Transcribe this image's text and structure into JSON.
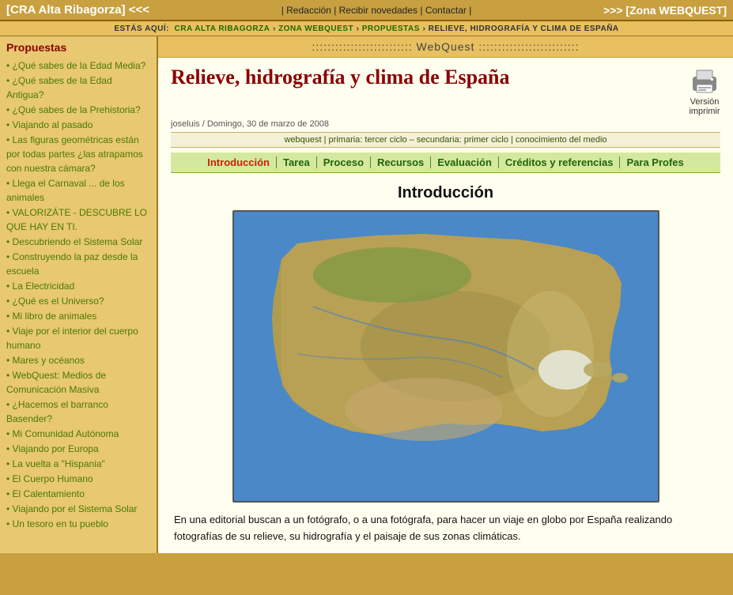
{
  "header": {
    "left": "[CRA Alta Ribagorza] <<<",
    "center_links": [
      "Redacción",
      "Recibir novedades",
      "Contactar"
    ],
    "right": ">>> [Zona WEBQUEST]"
  },
  "breadcrumb": {
    "label": "ESTÁS AQUÍ:",
    "parts": [
      "CRA ALTA RIBAGORZA",
      "ZONA WEBQUEST",
      "PROPUESTAS",
      "RELIEVE, HIDROGRAFÍA Y CLIMA DE ESPAÑA"
    ]
  },
  "wq_banner": ":::::::::::::::::::::::::: WebQuest ::::::::::::::::::::::::::",
  "sidebar": {
    "title": "Propuestas",
    "items": [
      "• ¿Qué sabes de la Edad Media?",
      "• ¿Qué sabes de la Edad Antigua?",
      "• ¿Qué sabes de la Prehistoria?",
      "• Viajando al pasado",
      "• Las figuras geométricas están por todas partes ¿las atrapamos con nuestra cámara?",
      "• Llega el Carnaval ... de los animales",
      "• VALORIZÁTE - DESCUBRE LO QUE HAY EN TI.",
      "• Descubriendo el Sistema Solar",
      "• Construyendo la paz desde la escuela",
      "• La Electricidad",
      "• ¿Qué es el Universo?",
      "• Mi libro de animales",
      "• Viaje por el interior del cuerpo humano",
      "• Mares y océanos",
      "• WebQuest: Medios de Comunicación Masiva",
      "• ¿Hacemos el barranco Basender?",
      "• Mi Comunidad Autónoma",
      "• Viajando por Europa",
      "• La vuelta a \"Hispania\"",
      "• El Cuerpo Humano",
      "• El Calentamiento",
      "• Viajando por el Sistema Solar",
      "• Un tesoro en tu pueblo"
    ]
  },
  "page": {
    "title": "Relieve, hidrografía y clima de España",
    "author_date": "joseluis / Domingo, 30 de marzo de 2008",
    "tags": "webquest | primaria: tercer ciclo – secundaria: primer ciclo | conocimiento del medio",
    "print_label": "Versión imprimir",
    "nav_tabs": [
      {
        "label": "Introducción",
        "active": true
      },
      {
        "label": "Tarea",
        "active": false
      },
      {
        "label": "Proceso",
        "active": false
      },
      {
        "label": "Recursos",
        "active": false
      },
      {
        "label": "Evaluación",
        "active": false
      },
      {
        "label": "Créditos y referencias",
        "active": false
      },
      {
        "label": "Para Profes",
        "active": false
      }
    ],
    "section_title": "Introducción",
    "description": "En una editorial buscan a un fotógrafo, o a una fotógrafa, para hacer un viaje en globo por España realizando fotografías de su relieve, su hidrografía y el paisaje de sus zonas climáticas."
  }
}
